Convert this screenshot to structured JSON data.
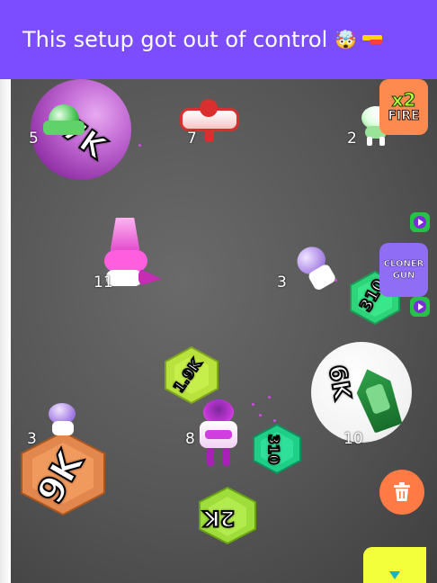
{
  "header": {
    "title": "This setup got out of control",
    "emoji": "🤯"
  },
  "colors": {
    "header_bg": "#7c4dff",
    "screen_bg": "#555555",
    "fire_button": "#ff8a50",
    "cloner_button": "#8f6df5",
    "trash_button": "#ff7a45",
    "yellow_tab": "#f2ff3a"
  },
  "game": {
    "turrets": [
      {
        "id": "turret-5",
        "level": "5"
      },
      {
        "id": "turret-7",
        "level": "7"
      },
      {
        "id": "turret-2",
        "level": "2"
      },
      {
        "id": "turret-11",
        "level": "11"
      },
      {
        "id": "turret-3a",
        "level": "3"
      },
      {
        "id": "turret-8",
        "level": "8"
      },
      {
        "id": "turret-10",
        "level": "10"
      },
      {
        "id": "turret-3b",
        "level": "3"
      }
    ],
    "targets": [
      {
        "id": "purple-sphere",
        "value": "7K"
      },
      {
        "id": "green-hex-right",
        "value": "310"
      },
      {
        "id": "yellow-hex",
        "value": "1.9K"
      },
      {
        "id": "white-sphere",
        "value": "6K"
      },
      {
        "id": "green-hex-center",
        "value": "310"
      },
      {
        "id": "orange-hex",
        "value": "9K"
      },
      {
        "id": "lime-hex",
        "value": "2K"
      }
    ]
  },
  "side_buttons": {
    "fire_multiplier": "x2",
    "fire_label": "FIRE",
    "cloner_line1": "CLONER",
    "cloner_line2": "GUN"
  },
  "icons": {
    "trash": "trash-icon",
    "play": "play-icon",
    "down": "chevron-down-icon",
    "gun": "gun-icon"
  }
}
